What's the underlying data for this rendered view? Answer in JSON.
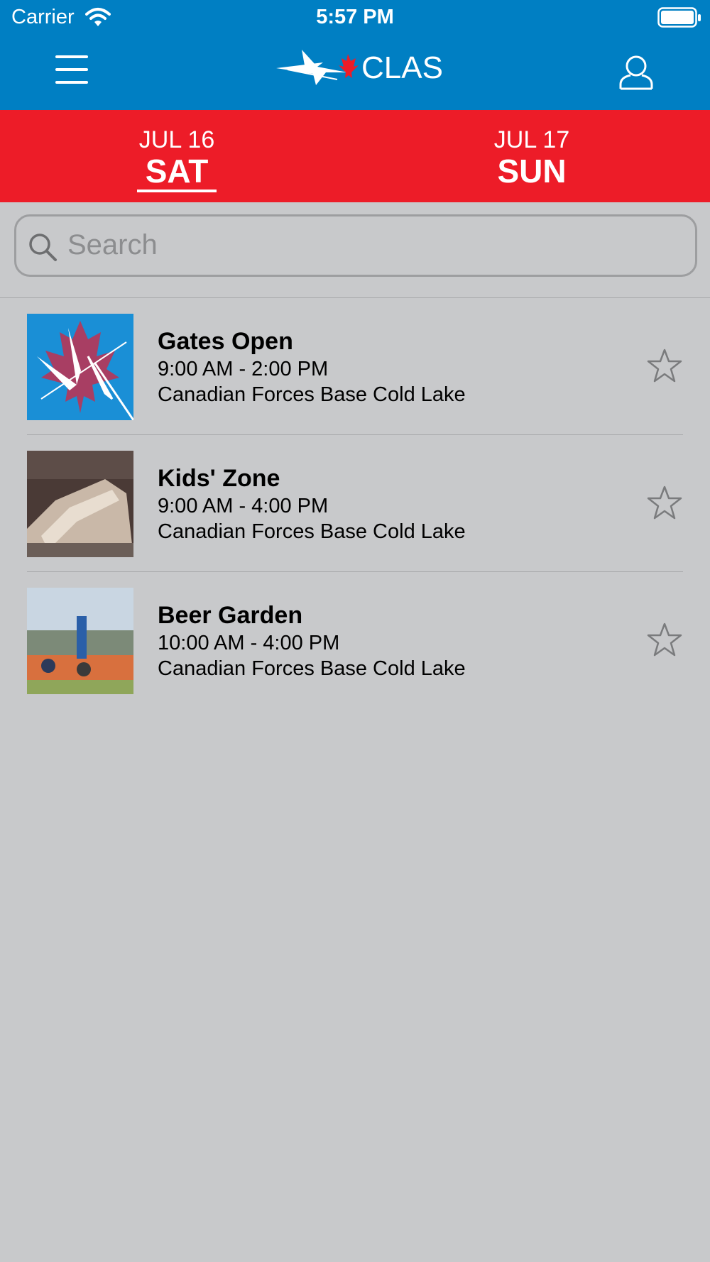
{
  "status_bar": {
    "carrier": "Carrier",
    "time": "5:57 PM"
  },
  "header": {
    "logo_text": "CLAS",
    "menu_icon": "hamburger-icon",
    "profile_icon": "user-icon",
    "color": "#007fc3"
  },
  "days": {
    "color": "#ed1c28",
    "items": [
      {
        "date": "JUL 16",
        "weekday": "SAT",
        "selected": true
      },
      {
        "date": "JUL 17",
        "weekday": "SUN",
        "selected": false
      }
    ]
  },
  "search": {
    "placeholder": "Search",
    "value": ""
  },
  "events": [
    {
      "title": "Gates Open",
      "time": "9:00 AM - 2:00 PM",
      "location": "Canadian Forces Base Cold Lake",
      "favorite": false
    },
    {
      "title": "Kids' Zone",
      "time": "9:00 AM - 4:00 PM",
      "location": "Canadian Forces Base Cold Lake",
      "favorite": false
    },
    {
      "title": "Beer Garden",
      "time": "10:00 AM - 4:00 PM",
      "location": "Canadian Forces Base Cold Lake",
      "favorite": false
    }
  ]
}
